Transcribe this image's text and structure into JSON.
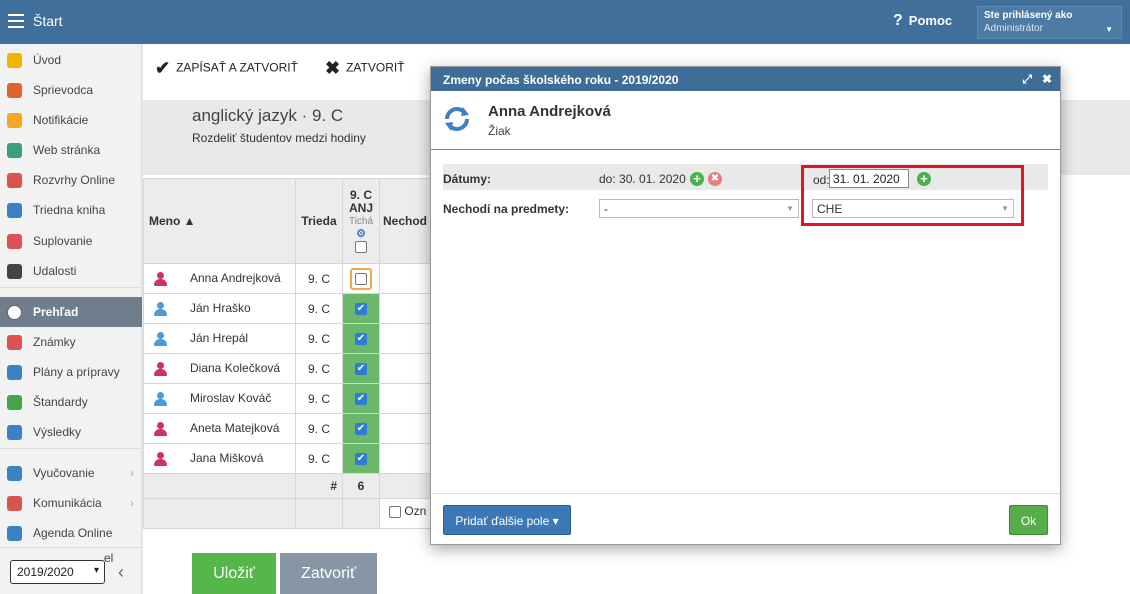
{
  "topbar": {
    "app_title": "Štart",
    "help_label": "Pomoc",
    "user_label": "Ste prihlásený ako",
    "user_name": "Administrátor"
  },
  "sidebar": {
    "items": [
      {
        "label": "Úvod",
        "icon": "star-icon",
        "color": "#f0b400"
      },
      {
        "label": "Sprievodca",
        "icon": "magic-wand-icon",
        "color": "#e0652a"
      },
      {
        "label": "Notifikácie",
        "icon": "envelope-icon",
        "color": "#f5a623"
      },
      {
        "label": "Web stránka",
        "icon": "home-icon",
        "color": "#3aa07a"
      },
      {
        "label": "Rozvrhy Online",
        "icon": "calendar-grid-icon",
        "color": "#d9534f"
      },
      {
        "label": "Triedna kniha",
        "icon": "book-icon",
        "color": "#3b82c4"
      },
      {
        "label": "Suplovanie",
        "icon": "user-swap-icon",
        "color": "#e05252"
      },
      {
        "label": "Udalosti",
        "icon": "calendar-icon",
        "color": "#444444"
      },
      {
        "label": "Prehľad",
        "icon": "check-circle-icon",
        "color": "#ffffff"
      },
      {
        "label": "Známky",
        "icon": "grade-icon",
        "color": "#e05252"
      },
      {
        "label": "Plány a prípravy",
        "icon": "briefcase-icon",
        "color": "#3b82c4"
      },
      {
        "label": "Štandardy",
        "icon": "shield-check-icon",
        "color": "#45a34a"
      },
      {
        "label": "Výsledky",
        "icon": "bar-chart-icon",
        "color": "#3b82c4"
      },
      {
        "label": "Vyučovanie",
        "icon": "book-open-icon",
        "color": "#3b82c4"
      },
      {
        "label": "Komunikácia",
        "icon": "chat-icon",
        "color": "#d9534f"
      },
      {
        "label": "Agenda Online",
        "icon": "pen-icon",
        "color": "#3b82c4"
      }
    ],
    "partial_label": "el",
    "year": "2019/2020"
  },
  "toolbar": {
    "save_close_label": "ZAPÍSAŤ A ZATVORIŤ",
    "close_label": "ZATVORIŤ"
  },
  "subject": {
    "title": "anglický jazyk · 9. C",
    "subtitle": "Rozdeliť študentov medzi hodiny"
  },
  "table": {
    "col_name": "Meno ▲",
    "col_class": "Trieda",
    "col_group_line1": "9. C",
    "col_group_line2": "ANJ",
    "col_group_line3": "Tichá",
    "col_partial": "Nechod",
    "rows": [
      {
        "name": "Anna Andrejková",
        "class": "9. C",
        "gender": "f",
        "checked": false,
        "pending": true
      },
      {
        "name": "Ján Hraško",
        "class": "9. C",
        "gender": "m",
        "checked": true,
        "pending": false
      },
      {
        "name": "Ján Hrepál",
        "class": "9. C",
        "gender": "m",
        "checked": true,
        "pending": false
      },
      {
        "name": "Diana Kolečková",
        "class": "9. C",
        "gender": "f",
        "checked": true,
        "pending": false
      },
      {
        "name": "Miroslav Kováč",
        "class": "9. C",
        "gender": "m",
        "checked": true,
        "pending": false
      },
      {
        "name": "Aneta Matejková",
        "class": "9. C",
        "gender": "f",
        "checked": true,
        "pending": false
      },
      {
        "name": "Jana Mišková",
        "class": "9. C",
        "gender": "f",
        "checked": true,
        "pending": false
      }
    ],
    "count_symbol": "#",
    "count_value": "6",
    "mark_label": "Ozn"
  },
  "buttons": {
    "save": "Uložiť",
    "close": "Zatvoriť"
  },
  "modal": {
    "title": "Zmeny počas školského roku - 2019/2020",
    "person_name": "Anna Andrejková",
    "person_role": "Žiak",
    "dates_label": "Dátumy:",
    "date_to": "do: 30. 01. 2020",
    "date_from_label": "od:",
    "date_from_value": "31. 01. 2020",
    "not_attend_label": "Nechodí na predmety:",
    "select_left_value": "-",
    "select_right_value": "CHE",
    "add_fields_label": "Pridať ďalšie pole ▾",
    "ok_label": "Ok"
  }
}
